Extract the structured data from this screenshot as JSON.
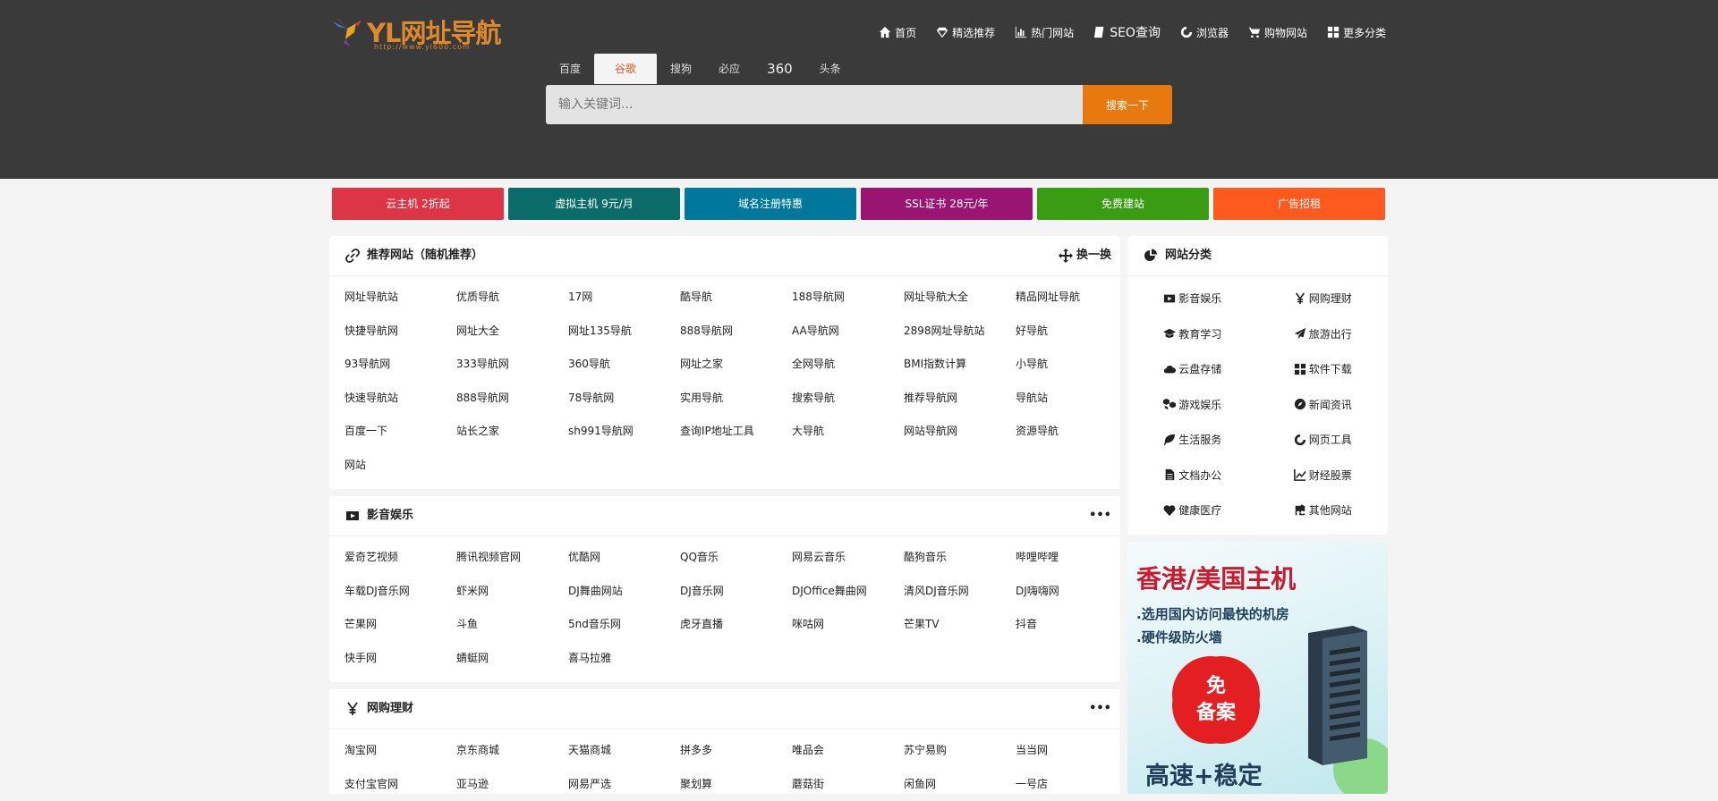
{
  "header": {
    "logo_text": "YL网址导航",
    "logo_url": "http://www.yl600.com",
    "nav": [
      {
        "icon": "home-icon",
        "label": "首页"
      },
      {
        "icon": "diamond-icon",
        "label": "精选推荐"
      },
      {
        "icon": "bar-chart-icon",
        "label": "热门网站"
      },
      {
        "icon": "book-icon",
        "label": "SEO查询"
      },
      {
        "icon": "browser-icon",
        "label": "浏览器"
      },
      {
        "icon": "cart-icon",
        "label": "购物网站"
      },
      {
        "icon": "grid-icon",
        "label": "更多分类"
      }
    ]
  },
  "search": {
    "tabs": [
      "百度",
      "谷歌",
      "搜狗",
      "必应",
      "360",
      "头条"
    ],
    "active_tab": 1,
    "placeholder": "输入关键词...",
    "button": "搜索一下"
  },
  "promos": [
    {
      "label": "云主机 2折起",
      "color": "#dc3545"
    },
    {
      "label": "虚拟主机 9元/月",
      "color": "#0b6b68"
    },
    {
      "label": "域名注册特惠",
      "color": "#00789c"
    },
    {
      "label": "SSL证书 28元/年",
      "color": "#9a1571"
    },
    {
      "label": "免费建站",
      "color": "#3a9c13"
    },
    {
      "label": "广告招租",
      "color": "#fd5a20"
    }
  ],
  "sections": [
    {
      "title": "推荐网站（随机推荐）",
      "icon": "link-icon",
      "right_label": "换一换",
      "links": [
        "网址导航站",
        "优质导航",
        "17网",
        "酷导航",
        "188导航网",
        "网址导航大全",
        "精品网址导航",
        "快捷导航网",
        "网址大全",
        "网址135导航",
        "888导航网",
        "AA导航网",
        "2898网址导航站",
        "好导航",
        "93导航网",
        "333导航网",
        "360导航",
        "网址之家",
        "全网导航",
        "BMI指数计算",
        "小导航",
        "快速导航站",
        "888导航网",
        "78导航网",
        "实用导航",
        "搜索导航",
        "推荐导航网",
        "导航站",
        "百度一下",
        "站长之家",
        "sh991导航网",
        "查询IP地址工具",
        "大导航",
        "网站导航网",
        "资源导航",
        "网站"
      ]
    },
    {
      "title": "影音娱乐",
      "icon": "video-icon",
      "right_label": "•••",
      "links": [
        "爱奇艺视频",
        "腾讯视频官网",
        "优酷网",
        "QQ音乐",
        "网易云音乐",
        "酷狗音乐",
        "哔哩哔哩",
        "车载DJ音乐网",
        "虾米网",
        "DJ舞曲网站",
        "DJ音乐网",
        "DJOffice舞曲网",
        "清风DJ音乐网",
        "DJ嗨嗨网",
        "芒果网",
        "斗鱼",
        "5nd音乐网",
        "虎牙直播",
        "咪咕网",
        "芒果TV",
        "抖音",
        "快手网",
        "蜻蜓网",
        "喜马拉雅"
      ]
    },
    {
      "title": "网购理财",
      "icon": "yen-icon",
      "right_label": "•••",
      "links": [
        "淘宝网",
        "京东商城",
        "天猫商城",
        "拼多多",
        "唯品会",
        "苏宁易购",
        "当当网",
        "支付宝官网",
        "亚马逊",
        "网易严选",
        "聚划算",
        "蘑菇街",
        "闲鱼网",
        "一号店"
      ]
    }
  ],
  "sidebar": {
    "title": "网站分类",
    "icon": "pie-chart-icon",
    "items": [
      {
        "icon": "video-icon",
        "label": "影音娱乐"
      },
      {
        "icon": "yen-icon",
        "label": "网购理财"
      },
      {
        "icon": "graduation-cap-icon",
        "label": "教育学习"
      },
      {
        "icon": "paper-plane-icon",
        "label": "旅游出行"
      },
      {
        "icon": "cloud-icon",
        "label": "云盘存储"
      },
      {
        "icon": "grid-icon",
        "label": "软件下载"
      },
      {
        "icon": "cubes-icon",
        "label": "游戏娱乐"
      },
      {
        "icon": "compass-icon",
        "label": "新闻资讯"
      },
      {
        "icon": "leaf-icon",
        "label": "生活服务"
      },
      {
        "icon": "browser-icon",
        "label": "网页工具"
      },
      {
        "icon": "file-icon",
        "label": "文档办公"
      },
      {
        "icon": "line-chart-icon",
        "label": "财经股票"
      },
      {
        "icon": "heartbeat-icon",
        "label": "健康医疗"
      },
      {
        "icon": "puzzle-icon",
        "label": "其他网站"
      }
    ]
  },
  "ad": {
    "headline": "香港/美国主机",
    "line1": ".选用国内访问最快的机房",
    "line2": ".硬件级防火墙",
    "badge_top": "免",
    "badge_bottom": "备案",
    "footer": "高速+稳定"
  }
}
